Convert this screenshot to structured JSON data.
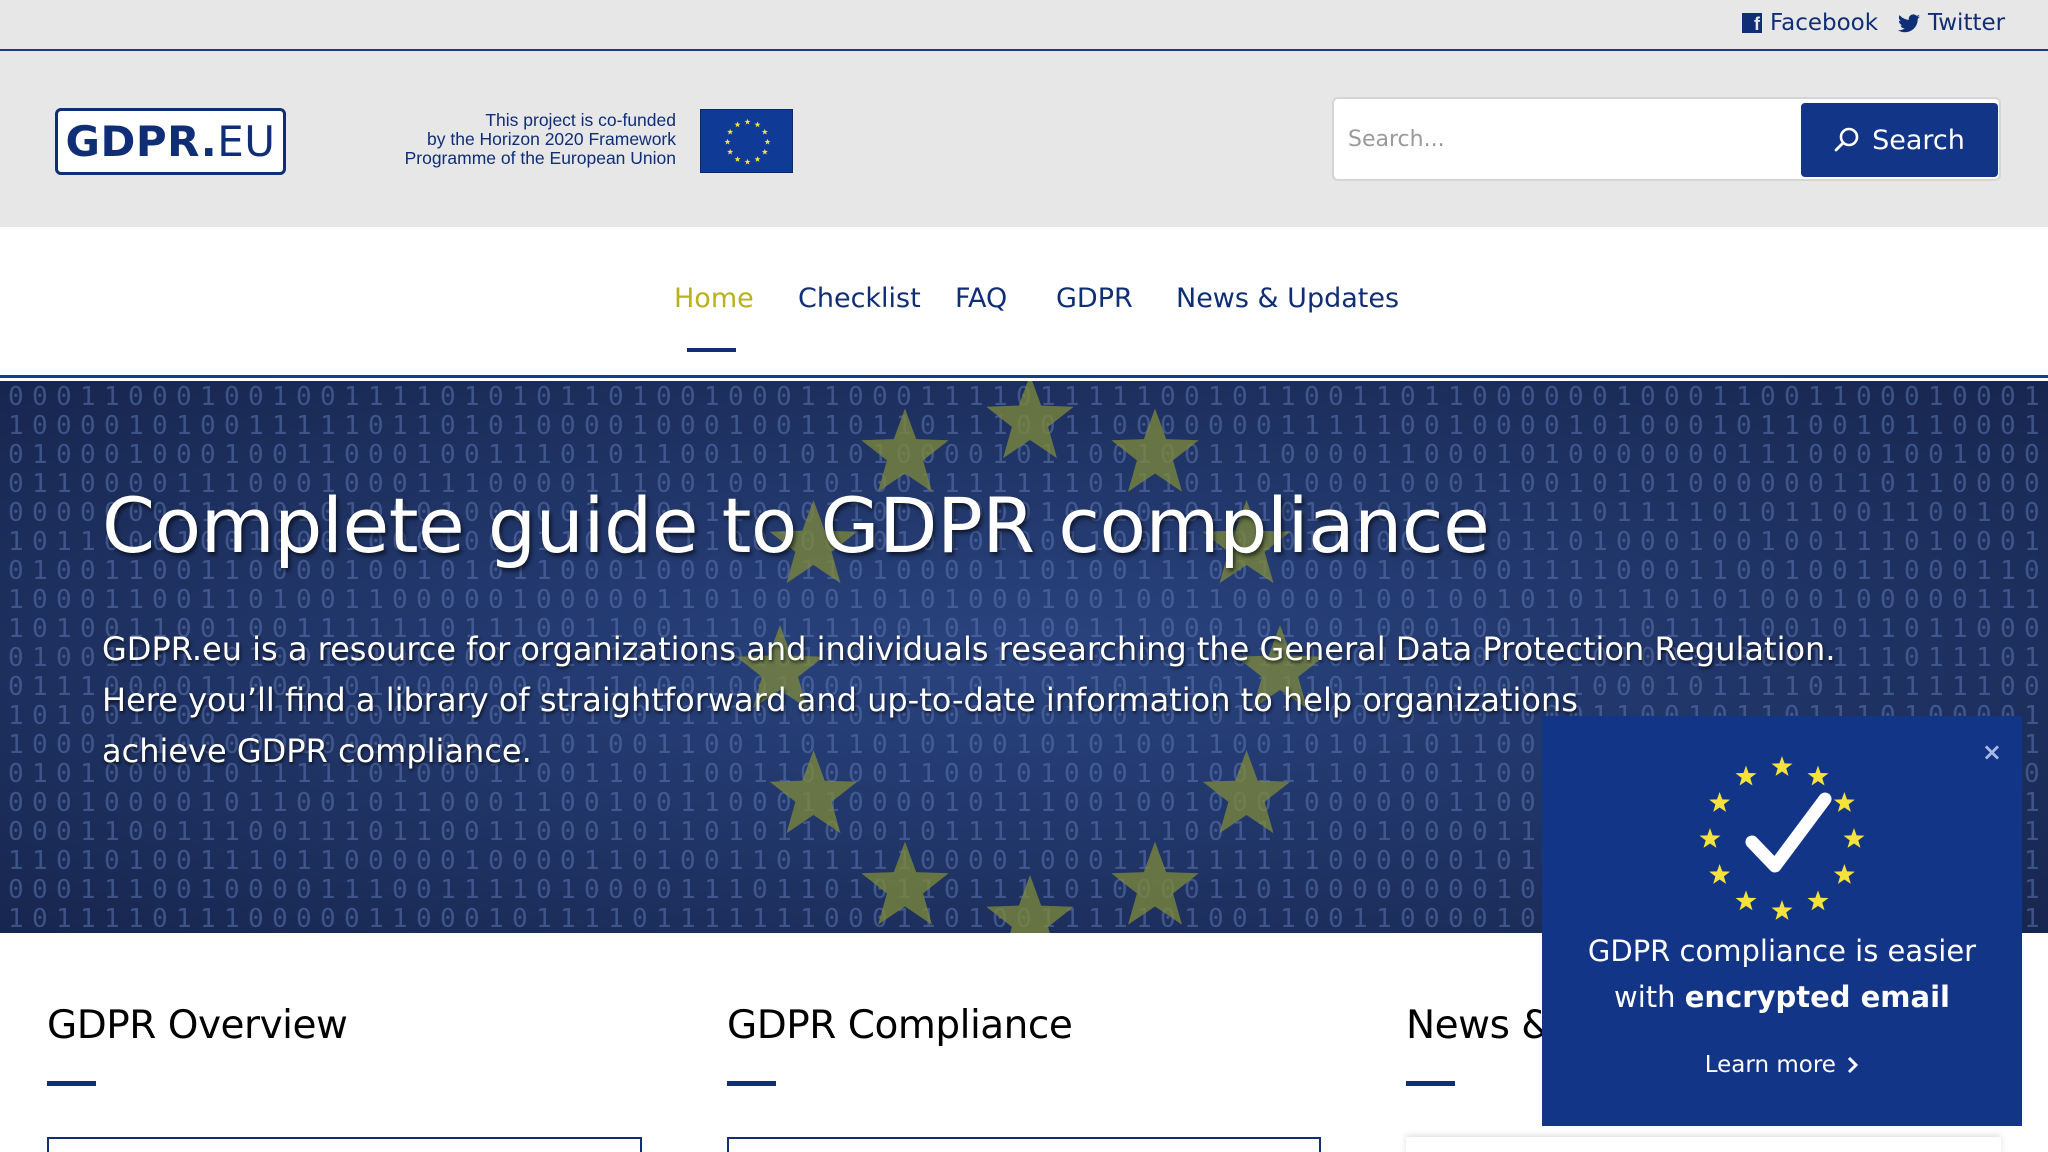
{
  "topbar": {
    "facebook_label": "Facebook",
    "twitter_label": "Twitter"
  },
  "header": {
    "logo_bold": "GDPR.",
    "logo_thin": "EU",
    "cofund_line1": "This project is co-funded",
    "cofund_line2": "by the Horizon 2020 Framework",
    "cofund_line3": "Programme of the European Union",
    "search_placeholder": "Search...",
    "search_button": "Search"
  },
  "nav": {
    "items": [
      {
        "label": "Home",
        "active": true
      },
      {
        "label": "Checklist",
        "active": false
      },
      {
        "label": "FAQ",
        "active": false
      },
      {
        "label": "GDPR",
        "active": false
      },
      {
        "label": "News & Updates",
        "active": false
      }
    ]
  },
  "hero": {
    "title": "Complete guide to GDPR compliance",
    "line1": "GDPR.eu is a resource for organizations and individuals researching the General Data Protection Regulation.",
    "line2": "Here you’ll find a library of straightforward and up-to-date information to help organizations",
    "line3": "achieve GDPR compliance."
  },
  "sections": [
    {
      "title": "GDPR Overview"
    },
    {
      "title": "GDPR Compliance"
    },
    {
      "title": "News & Updates"
    }
  ],
  "popup": {
    "close_label": "×",
    "text_line1": "GDPR compliance is easier",
    "text_line2_prefix": "with ",
    "text_line2_bold": "encrypted email",
    "link_label": "Learn more"
  },
  "colors": {
    "brand_blue": "#133587",
    "accent_yellow": "#b9b218",
    "header_gray": "#e7e7e7",
    "hero_bg": "#1f3468"
  }
}
